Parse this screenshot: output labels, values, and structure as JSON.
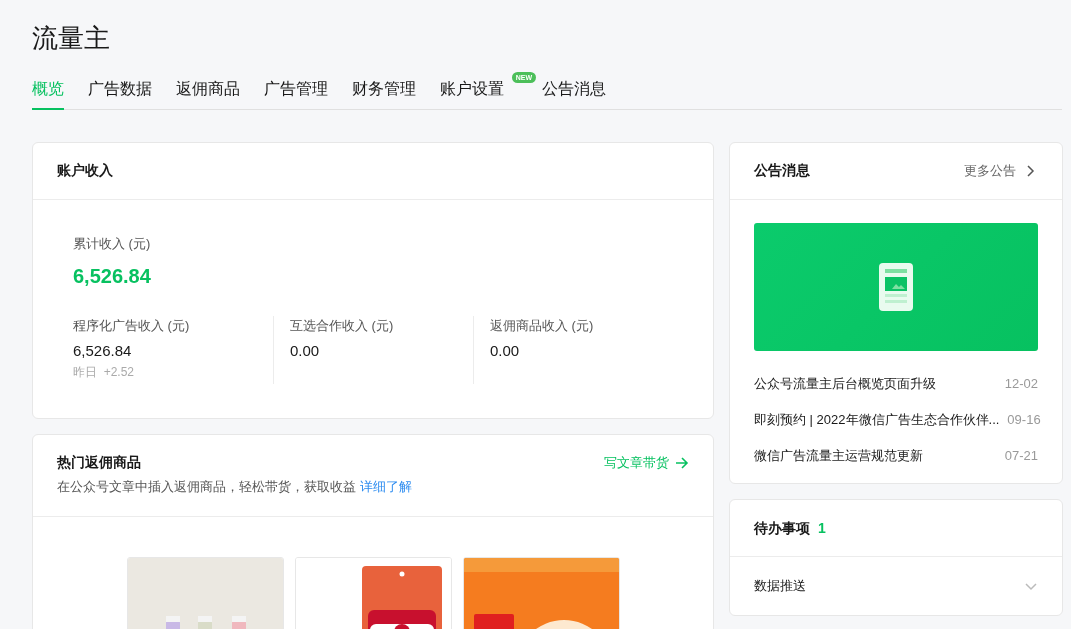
{
  "page_title": "流量主",
  "tabs": [
    {
      "label": "概览",
      "selected": true
    },
    {
      "label": "广告数据",
      "selected": false
    },
    {
      "label": "返佣商品",
      "selected": false
    },
    {
      "label": "广告管理",
      "selected": false
    },
    {
      "label": "财务管理",
      "selected": false
    },
    {
      "label": "账户设置",
      "selected": false,
      "badge": "NEW"
    },
    {
      "label": "公告消息",
      "selected": false
    }
  ],
  "income_card": {
    "title": "账户收入",
    "total_label": "累计收入 (元)",
    "total_value": "6,526.84",
    "breakdown": [
      {
        "label": "程序化广告收入 (元)",
        "value": "6,526.84",
        "yesterday_label": "昨日",
        "yesterday_value": "+2.52"
      },
      {
        "label": "互选合作收入 (元)",
        "value": "0.00"
      },
      {
        "label": "返佣商品收入 (元)",
        "value": "0.00"
      }
    ]
  },
  "products_card": {
    "title": "热门返佣商品",
    "subtitle": "在公众号文章中插入返佣商品，轻松带货，获取收益",
    "learn_more_link": "详细了解",
    "action": "写文章带货"
  },
  "announcements": {
    "title": "公告消息",
    "more_link": "更多公告",
    "items": [
      {
        "title": "公众号流量主后台概览页面升级",
        "date": "12-02"
      },
      {
        "title": "即刻预约 | 2022年微信广告生态合作伙伴...",
        "date": "09-16"
      },
      {
        "title": "微信广告流量主运营规范更新",
        "date": "07-21"
      }
    ]
  },
  "todo": {
    "title": "待办事项",
    "count": "1",
    "items": [
      {
        "label": "数据推送",
        "expanded": false
      }
    ]
  }
}
